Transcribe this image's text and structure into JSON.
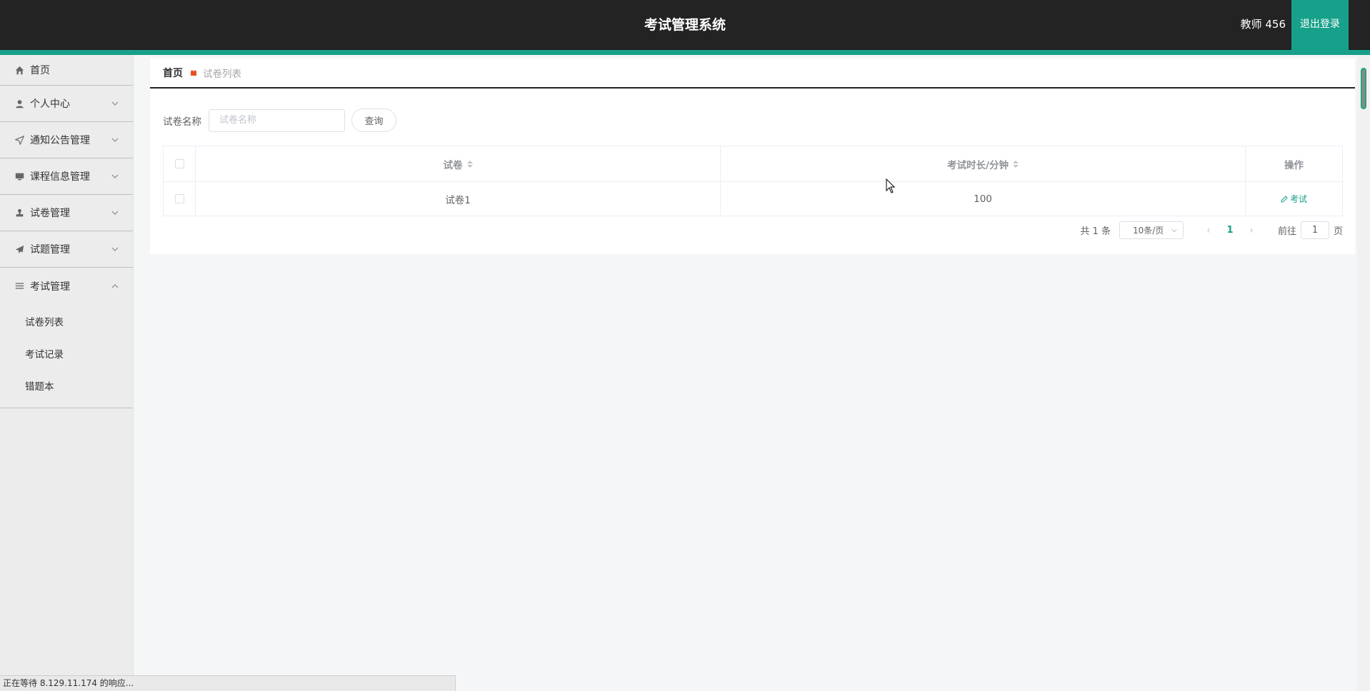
{
  "header": {
    "title": "考试管理系统",
    "user": "教师 456",
    "logout": "退出登录"
  },
  "sidebar": {
    "items": [
      {
        "label": "首页",
        "icon": "home-icon"
      },
      {
        "label": "个人中心",
        "icon": "user-icon"
      },
      {
        "label": "通知公告管理",
        "icon": "send-icon"
      },
      {
        "label": "课程信息管理",
        "icon": "monitor-icon"
      },
      {
        "label": "试卷管理",
        "icon": "stamp-icon"
      },
      {
        "label": "试题管理",
        "icon": "paper-plane-icon"
      },
      {
        "label": "考试管理",
        "icon": "menu-icon"
      }
    ],
    "sub_items": [
      "试卷列表",
      "考试记录",
      "错题本"
    ]
  },
  "breadcrumb": {
    "home": "首页",
    "current": "试卷列表"
  },
  "search": {
    "label": "试卷名称",
    "placeholder": "试卷名称",
    "button": "查询"
  },
  "table": {
    "columns": [
      "试卷",
      "考试时长/分钟",
      "操作"
    ],
    "rows": [
      {
        "name": "试卷1",
        "duration": "100",
        "action": "考试"
      }
    ]
  },
  "pagination": {
    "total": "共 1 条",
    "page_size": "10条/页",
    "current_page": "1",
    "jump_label": "前往",
    "jump_value": "1",
    "jump_suffix": "页"
  },
  "status_bar": "正在等待 8.129.11.174 的响应...",
  "colors": {
    "accent": "#17a08a",
    "header_bg": "#232323",
    "sidebar_bg": "#ececec"
  }
}
